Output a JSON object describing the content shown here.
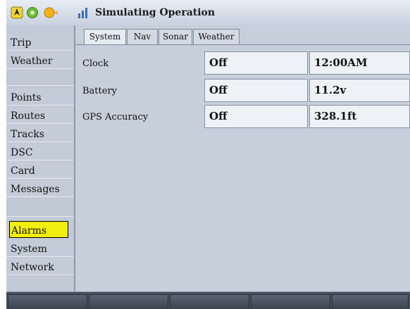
{
  "header": {
    "title": "Simulating Operation",
    "status_icons": [
      "position-icon",
      "gps-signal-icon",
      "sun-icon",
      "signal-bars-icon"
    ]
  },
  "sidebar": {
    "items": [
      {
        "label": "Trip",
        "state": "normal"
      },
      {
        "label": "Weather",
        "state": "normal"
      },
      {
        "label": "",
        "state": "disabled"
      },
      {
        "label": "Points",
        "state": "normal"
      },
      {
        "label": "Routes",
        "state": "normal"
      },
      {
        "label": "Tracks",
        "state": "normal"
      },
      {
        "label": "DSC",
        "state": "normal"
      },
      {
        "label": "Card",
        "state": "normal"
      },
      {
        "label": "Messages",
        "state": "normal"
      },
      {
        "label": "",
        "state": "disabled"
      },
      {
        "label": "Alarms",
        "state": "selected"
      },
      {
        "label": "System",
        "state": "normal"
      },
      {
        "label": "Network",
        "state": "normal"
      }
    ]
  },
  "tabs": [
    {
      "label": "System",
      "active": true
    },
    {
      "label": "Nav",
      "active": false
    },
    {
      "label": "Sonar",
      "active": false
    },
    {
      "label": "Weather",
      "active": false
    }
  ],
  "alarms": {
    "rows": [
      {
        "label": "Clock",
        "state": "Off",
        "value": "12:00AM"
      },
      {
        "label": "Battery",
        "state": "Off",
        "value": "11.2v"
      },
      {
        "label": "GPS Accuracy",
        "state": "Off",
        "value": "328.1ft"
      }
    ]
  },
  "colors": {
    "selected_highlight": "#f2ee10",
    "panel_background": "#c7cfdb",
    "softkey_bar": "#47505c"
  }
}
